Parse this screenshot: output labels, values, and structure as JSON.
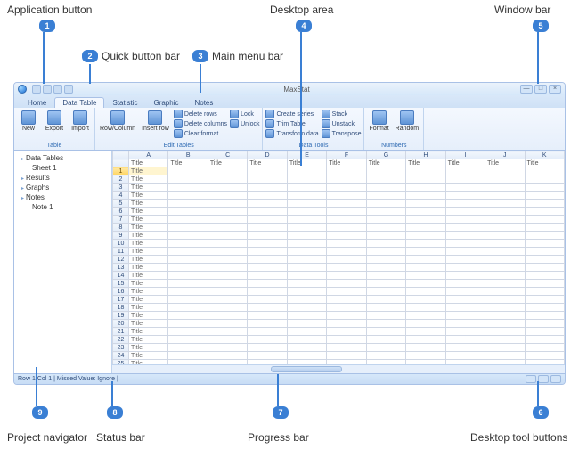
{
  "annotations": {
    "a1": "Application button",
    "a2": "Quick button bar",
    "a3": "Main menu bar",
    "a4": "Desktop area",
    "a5": "Window bar",
    "a6": "Desktop tool buttons",
    "a7": "Progress bar",
    "a8": "Status bar",
    "a9": "Project navigator"
  },
  "window": {
    "title": "MaxStat"
  },
  "tabs": [
    "Home",
    "Data Table",
    "Statistic",
    "Graphic",
    "Notes"
  ],
  "active_tab": "Data Table",
  "ribbon": {
    "groups": [
      {
        "label": "Table",
        "big": [
          {
            "label": "New"
          },
          {
            "label": "Export"
          },
          {
            "label": "Import"
          }
        ]
      },
      {
        "label": "Edit Tables",
        "big": [
          {
            "label": "Row/Column"
          },
          {
            "label": "Insert row"
          }
        ],
        "small": [
          "Delete rows",
          "Delete columns",
          "Clear format"
        ],
        "small2": [
          "Lock",
          "Unlock"
        ]
      },
      {
        "label": "Data Tools",
        "small": [
          "Create series",
          "Trim Table",
          "Transform data"
        ],
        "small2": [
          "Stack",
          "Unstack",
          "Transpose"
        ]
      },
      {
        "label": "Numbers",
        "big": [
          {
            "label": "Format"
          },
          {
            "label": "Random"
          }
        ]
      }
    ]
  },
  "navigator": {
    "items": [
      {
        "label": "Data Tables",
        "level": 0
      },
      {
        "label": "Sheet 1",
        "level": 1
      },
      {
        "label": "Results",
        "level": 0
      },
      {
        "label": "Graphs",
        "level": 0
      },
      {
        "label": "Notes",
        "level": 0
      },
      {
        "label": "Note 1",
        "level": 1
      }
    ]
  },
  "sheet": {
    "col_letters": [
      "A",
      "B",
      "C",
      "D",
      "E",
      "F",
      "G",
      "H",
      "I",
      "J",
      "K"
    ],
    "header_repeat": "Title",
    "row_count": 27,
    "cell_value": "Title"
  },
  "status": {
    "text": "Row 1 Col 1 | Missed Value: Ignore |"
  }
}
